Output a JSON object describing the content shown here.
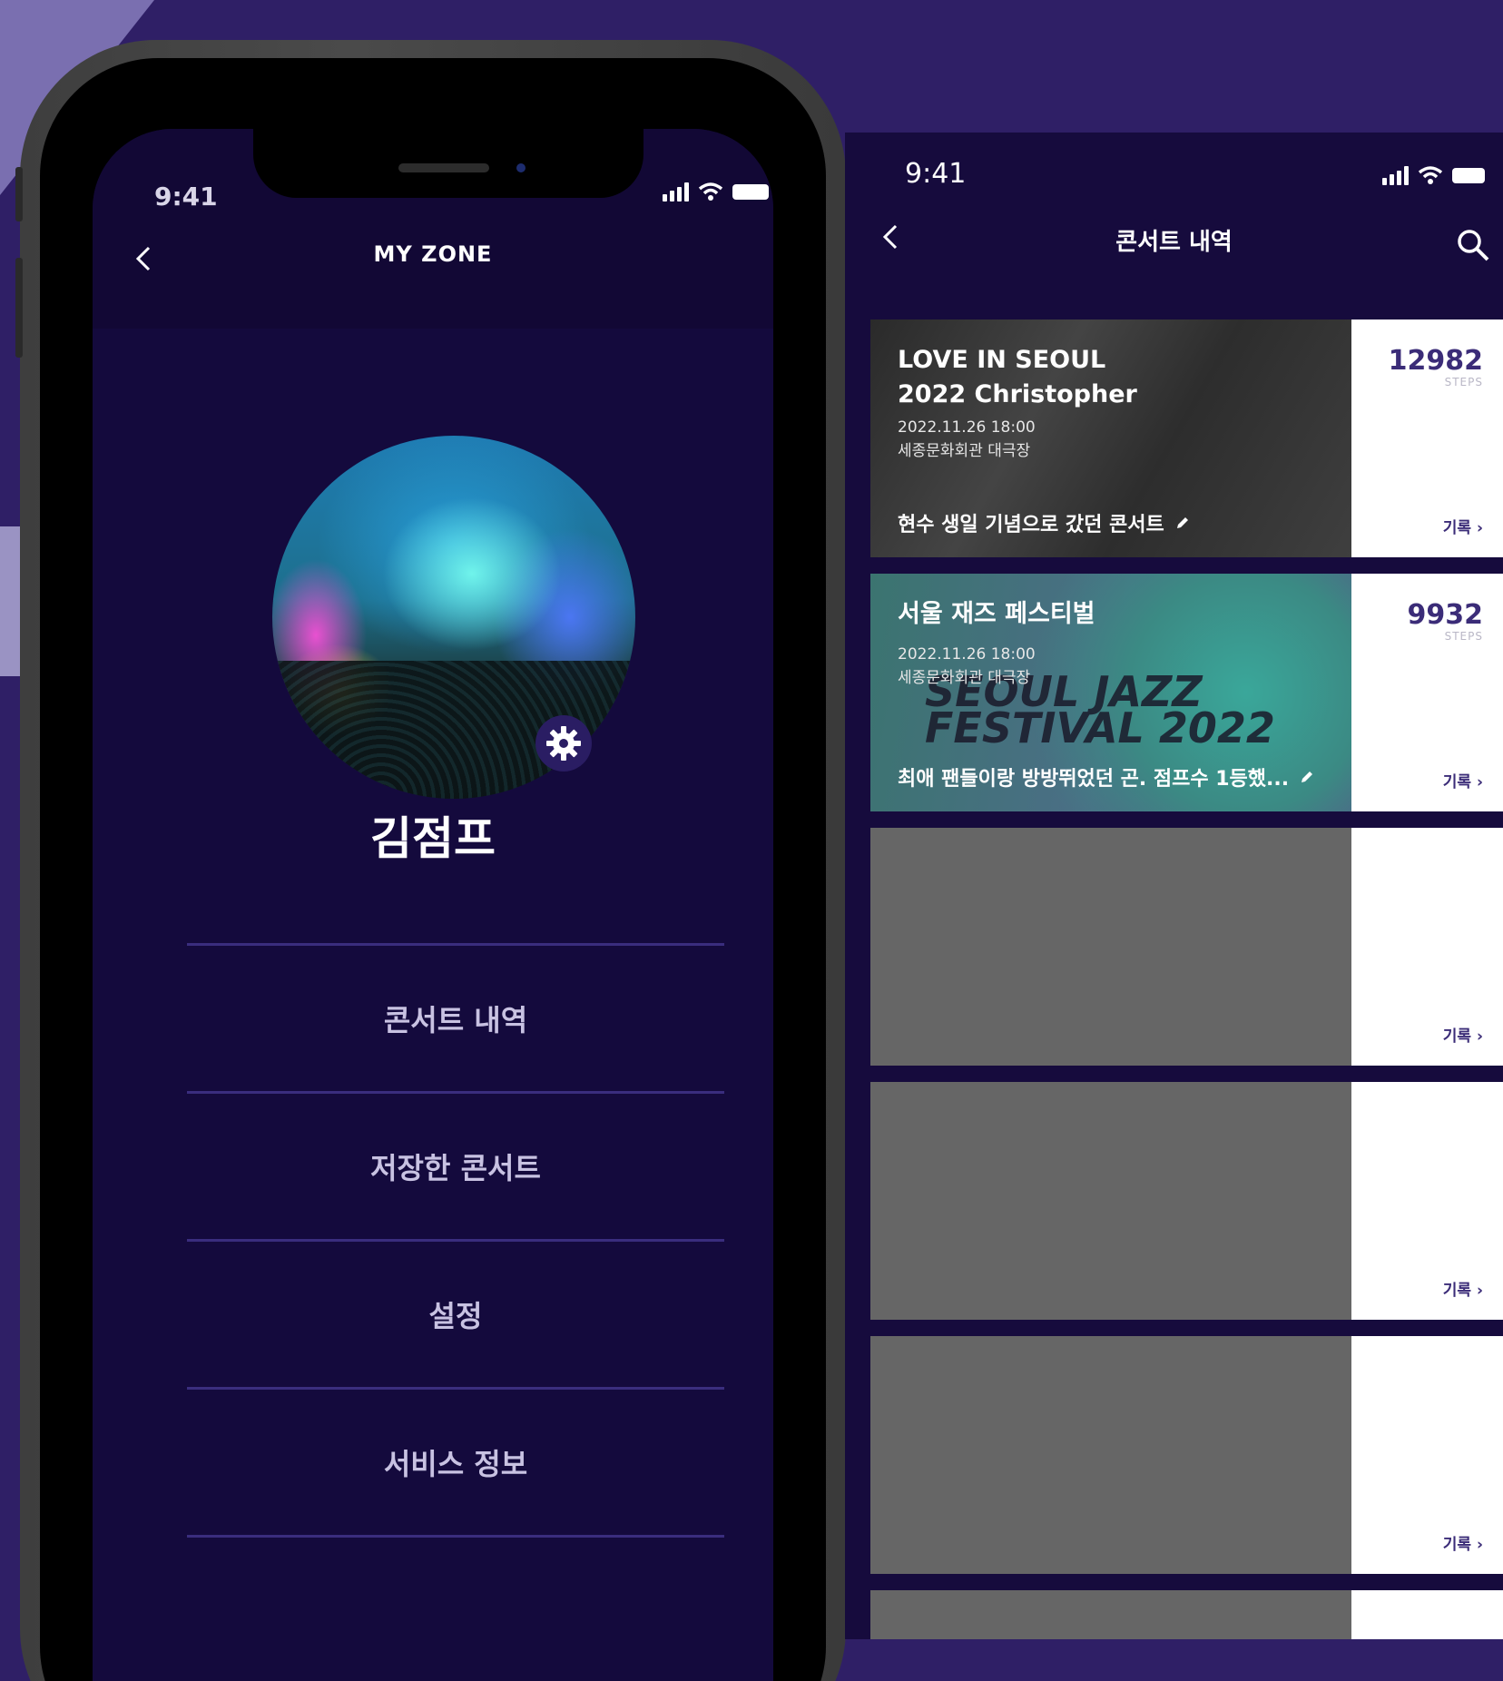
{
  "left_phone": {
    "status_time": "9:41",
    "title": "MY ZONE",
    "username": "김점프",
    "menu": [
      {
        "label": "콘서트 내역"
      },
      {
        "label": "저장한 콘서트"
      },
      {
        "label": "설정"
      },
      {
        "label": "서비스 정보"
      }
    ]
  },
  "right_screen": {
    "status_time": "9:41",
    "title": "콘서트 내역",
    "record_label": "기록 ›",
    "cards": [
      {
        "title_line1": "LOVE IN SEOUL",
        "title_line2": "2022 Christopher",
        "date": "2022.11.26 18:00",
        "venue": "세종문화회관 대극장",
        "memo": "현수 생일 기념으로 갔던 콘서트",
        "steps": "12982",
        "steps_label": "STEPS"
      },
      {
        "title_line1": "서울 재즈 페스티벌",
        "date": "2022.11.26 18:00",
        "venue": "세종문화회관 대극장",
        "memo": "최애 팬들이랑 방방뛰었던 곤. 점프수 1등했...",
        "steps": "9932",
        "steps_label": "STEPS",
        "poster_text": "SEOUL JAZZ FESTIVAL 2022"
      }
    ]
  },
  "colors": {
    "background": "#2f1f66",
    "screen": "#140a3d",
    "accent": "#3b2c78"
  }
}
